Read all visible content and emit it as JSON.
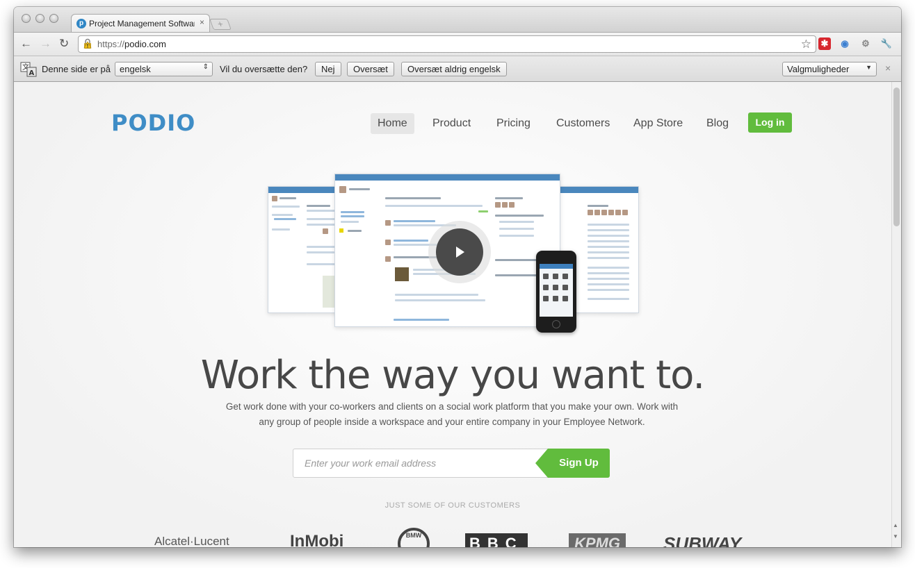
{
  "browser": {
    "tab_title": "Project Management Software",
    "tab_close": "×",
    "new_tab": "+",
    "url_scheme": "https://",
    "url_host": "podio.com"
  },
  "translate_bar": {
    "prefix": "Denne side er på",
    "language": "engelsk",
    "question": "Vil du oversætte den?",
    "no_button": "Nej",
    "translate_button": "Oversæt",
    "never_button": "Oversæt aldrig engelsk",
    "options": "Valgmuligheder",
    "close": "×"
  },
  "site": {
    "logo": "PODIO",
    "nav": [
      "Home",
      "Product",
      "Pricing",
      "Customers",
      "App Store",
      "Blog"
    ],
    "login": "Log in",
    "headline": "Work the way you want to.",
    "subtext": "Get work done with your co-workers and clients on a social work platform that you make your own. Work with any group of people inside a workspace and your entire company in your Employee Network.",
    "email_placeholder": "Enter your work email address",
    "signup": "Sign Up",
    "customers_label": "JUST SOME OF OUR CUSTOMERS",
    "customers": [
      "Alcatel·Lucent",
      "InMobi",
      "BMW",
      "BBC",
      "KPMG",
      "SUBWAY"
    ]
  },
  "colors": {
    "brand_blue": "#3f8dc6",
    "accent_green": "#61bc3d"
  },
  "icons": [
    "back-icon",
    "forward-icon",
    "reload-icon",
    "warning-lock-icon",
    "star-icon",
    "wrench-icon",
    "translate-icon",
    "play-icon"
  ]
}
